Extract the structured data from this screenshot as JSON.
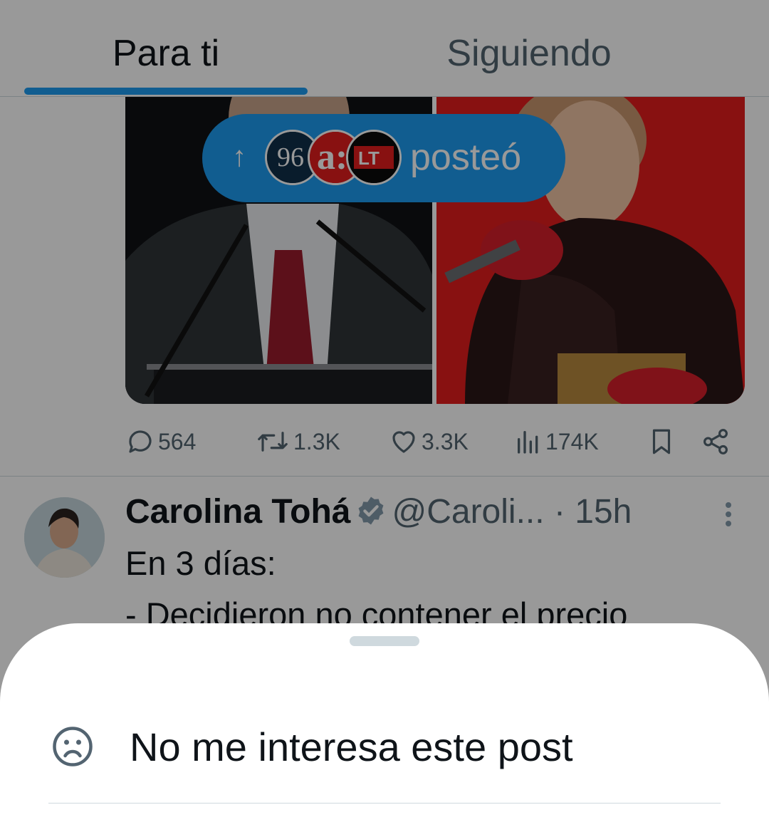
{
  "tabs": {
    "for_you": "Para ti",
    "following": "Siguiendo",
    "active": "Para ti"
  },
  "reposted_pill": {
    "arrow": "↑",
    "label": "posteó",
    "avatars": [
      "9/6 logo",
      "a: logo",
      "LT logo"
    ]
  },
  "tweet1": {
    "replies": "564",
    "reposts": "1.3K",
    "likes": "3.3K",
    "views": "174K"
  },
  "tweet2": {
    "author_name": "Carolina Tohá",
    "handle": "@Caroli...",
    "time": "· 15h",
    "text": "En 3 días:\n- Decidieron no contener el precio"
  },
  "sheet": {
    "option_label": "No me interesa este post"
  },
  "colors": {
    "accent": "#1d9bf0",
    "text_primary": "#0f1419",
    "text_secondary": "#536471",
    "verified_badge": "#829aab"
  },
  "icons": [
    "reply-icon",
    "repost-icon",
    "like-icon",
    "views-icon",
    "bookmark-icon",
    "share-icon",
    "verified-icon",
    "more-icon",
    "sad-face-icon",
    "arrow-up-icon"
  ]
}
